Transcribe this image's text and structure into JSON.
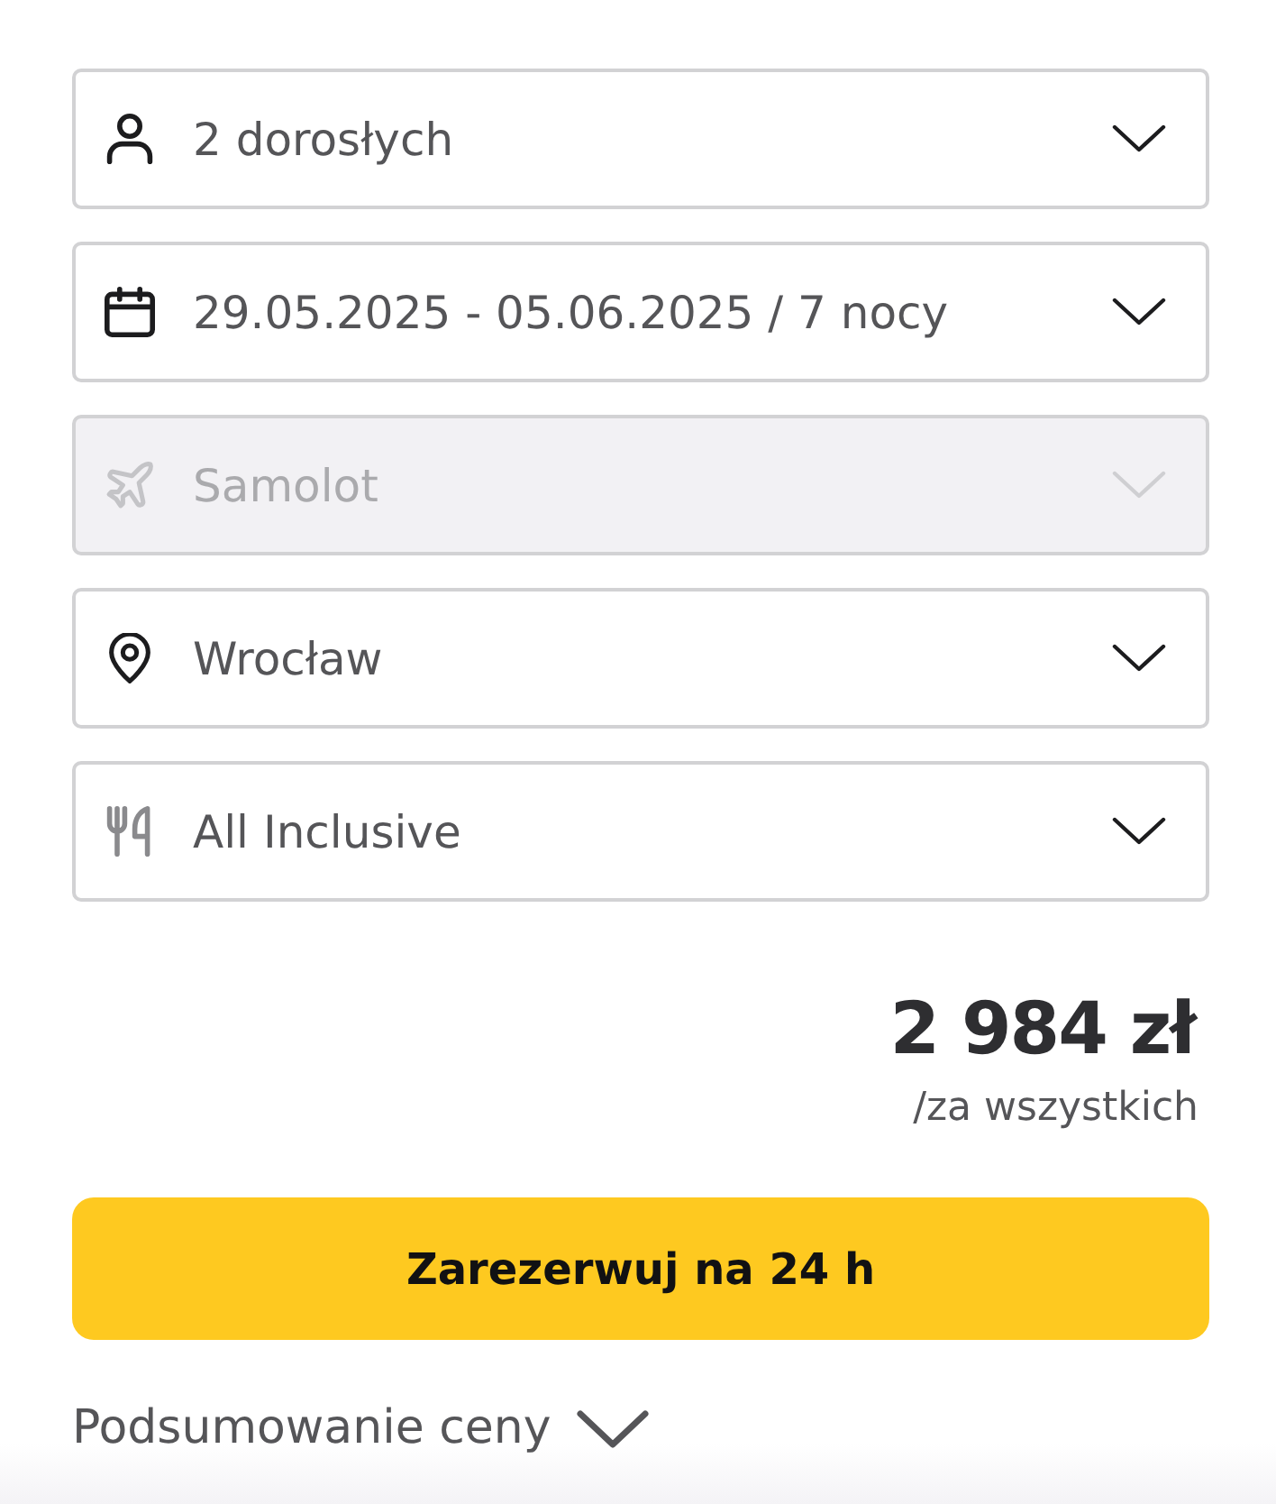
{
  "fields": [
    {
      "kind": "travelers",
      "value": "2 dorosłych",
      "disabled": false
    },
    {
      "kind": "dates",
      "value": "29.05.2025 - 05.06.2025 / 7 nocy",
      "disabled": false
    },
    {
      "kind": "transport",
      "value": "Samolot",
      "disabled": true
    },
    {
      "kind": "departure",
      "value": "Wrocław",
      "disabled": false
    },
    {
      "kind": "board",
      "value": "All Inclusive",
      "disabled": false
    }
  ],
  "price": {
    "amount": "2 984 zł",
    "note": "/za wszystkich"
  },
  "reserve_button": {
    "label": "Zarezerwuj na 24 h"
  },
  "summary_toggle": {
    "label": "Podsumowanie ceny",
    "expanded": false
  }
}
